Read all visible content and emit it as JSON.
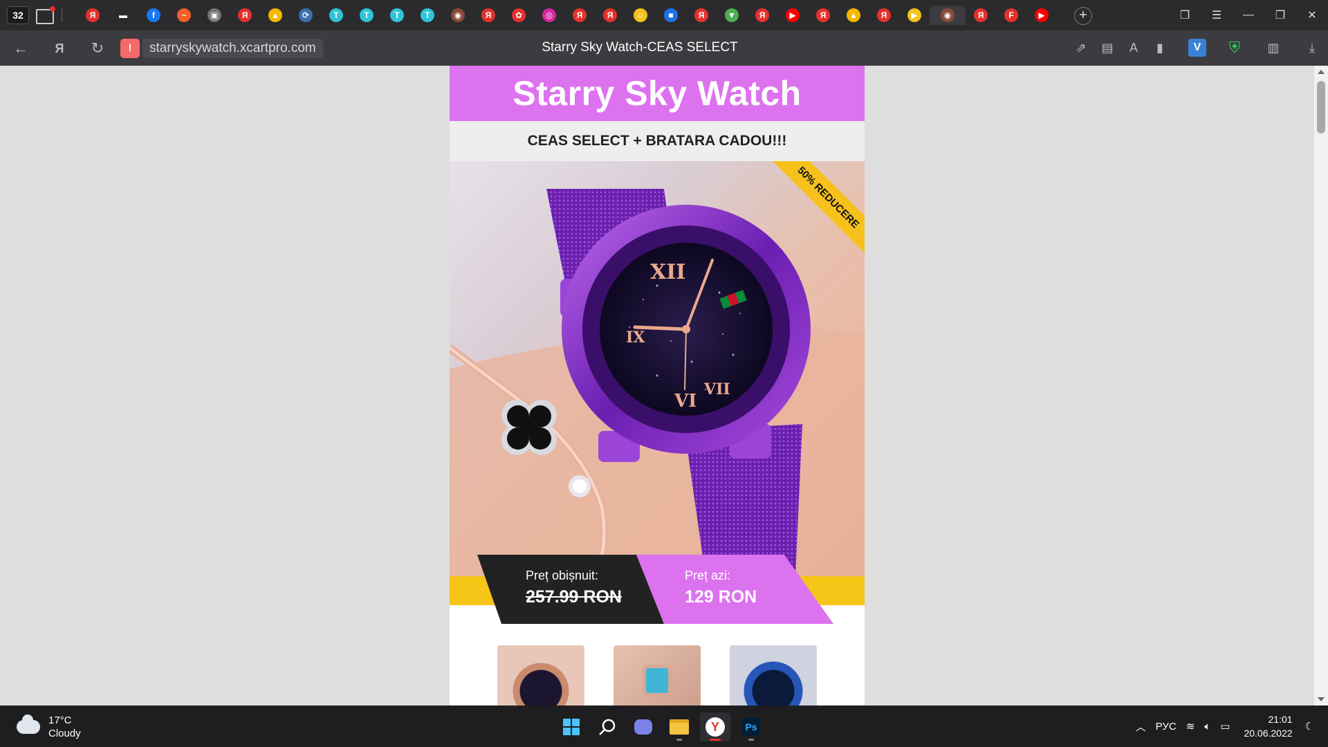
{
  "browser": {
    "tab_count": "32",
    "url": "starryskywatch.xcartpro.com",
    "page_title": "Starry Sky Watch-CEAS SELECT",
    "pinned_tabs": [
      {
        "icon": "yandex-icon",
        "color": "#e5312c",
        "glyph": "Я"
      },
      {
        "icon": "mail-icon",
        "color": "#2b2b2e",
        "glyph": "▬"
      },
      {
        "icon": "facebook-icon",
        "color": "#1877f2",
        "glyph": "f"
      },
      {
        "icon": "pulse-icon",
        "color": "#f0602a",
        "glyph": "~"
      },
      {
        "icon": "image-icon",
        "color": "#777777",
        "glyph": "▣"
      },
      {
        "icon": "yandex-icon",
        "color": "#e5312c",
        "glyph": "Я"
      },
      {
        "icon": "photos-icon",
        "color": "#f5b800",
        "glyph": "▲"
      },
      {
        "icon": "python-icon",
        "color": "#3b6fb0",
        "glyph": "⟳"
      },
      {
        "icon": "shirt-icon",
        "color": "#2ec4d6",
        "glyph": "T"
      },
      {
        "icon": "shirt-icon",
        "color": "#2ec4d6",
        "glyph": "T"
      },
      {
        "icon": "shirt-icon",
        "color": "#2ec4d6",
        "glyph": "T"
      },
      {
        "icon": "shirt-icon",
        "color": "#2ec4d6",
        "glyph": "T"
      },
      {
        "icon": "watch-icon",
        "color": "#8b4a3a",
        "glyph": "◉"
      },
      {
        "icon": "yandex-icon",
        "color": "#e5312c",
        "glyph": "Я"
      },
      {
        "icon": "apps-icon",
        "color": "#e5312c",
        "glyph": "✿"
      },
      {
        "icon": "instagram-icon",
        "color": "#d6249f",
        "glyph": "◎"
      },
      {
        "icon": "yandex-icon",
        "color": "#e5312c",
        "glyph": "Я"
      },
      {
        "icon": "yandex-icon",
        "color": "#e5312c",
        "glyph": "Я"
      },
      {
        "icon": "smile-icon",
        "color": "#f5c11a",
        "glyph": "☺"
      },
      {
        "icon": "chat-icon",
        "color": "#1e72e8",
        "glyph": "■"
      },
      {
        "icon": "yandex-icon",
        "color": "#e5312c",
        "glyph": "Я"
      },
      {
        "icon": "download-icon",
        "color": "#4caf50",
        "glyph": "▼"
      },
      {
        "icon": "yandex-icon",
        "color": "#e5312c",
        "glyph": "Я"
      },
      {
        "icon": "youtube-icon",
        "color": "#ff0000",
        "glyph": "▶"
      },
      {
        "icon": "yandex-icon",
        "color": "#e5312c",
        "glyph": "Я"
      },
      {
        "icon": "photos-icon",
        "color": "#f5b800",
        "glyph": "▲"
      },
      {
        "icon": "yandex-icon",
        "color": "#e5312c",
        "glyph": "Я"
      },
      {
        "icon": "play-icon",
        "color": "#f5c11a",
        "glyph": "▶"
      },
      {
        "icon": "watch-icon",
        "color": "#8b4a3a",
        "glyph": "◉",
        "active": true
      },
      {
        "icon": "yandex-icon",
        "color": "#e5312c",
        "glyph": "Я"
      },
      {
        "icon": "flash-icon",
        "color": "#e5312c",
        "glyph": "F"
      },
      {
        "icon": "youtube-icon",
        "color": "#ff0000",
        "glyph": "▶"
      }
    ]
  },
  "landing": {
    "title": "Starry Sky Watch",
    "subtitle": "CEAS SELECT + BRATARA CADOU!!!",
    "ribbon": "50% REDUCERE",
    "price_old_label": "Preț obișnuit:",
    "price_old_value": "257.99 RON",
    "price_new_label": "Preț azi:",
    "price_new_value": "129 RON",
    "colors": {
      "accent": "#dd72ef",
      "yellow": "#f5c518",
      "dark": "#222222"
    }
  },
  "taskbar": {
    "temperature": "17°C",
    "condition": "Cloudy",
    "language": "РУС",
    "time": "21:01",
    "date": "20.06.2022",
    "apps": [
      "windows-start-icon",
      "search-icon",
      "meet-icon",
      "file-explorer-icon",
      "yandex-browser-icon",
      "photoshop-icon"
    ]
  }
}
